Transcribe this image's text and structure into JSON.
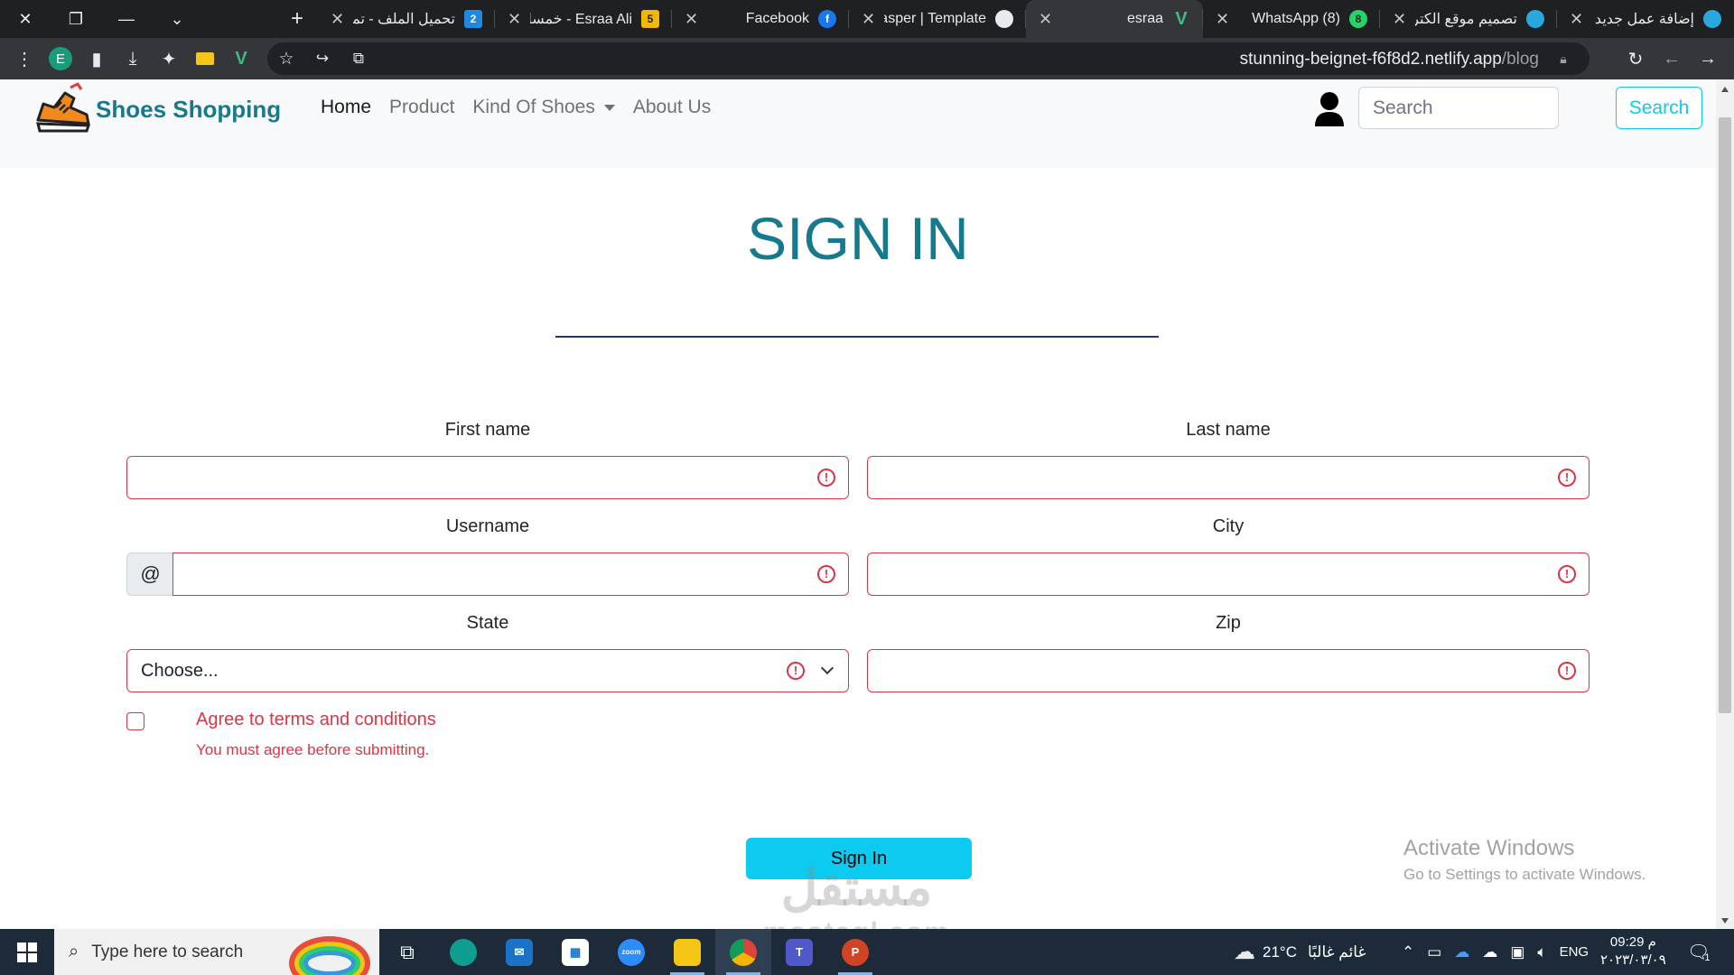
{
  "browser": {
    "tabs": [
      {
        "title": "إضافة عمل جديد |",
        "fav_color": "#29a8e0"
      },
      {
        "title": "تصميم موقع الكترو",
        "fav_color": "#29a8e0"
      },
      {
        "title": "(8) WhatsApp",
        "fav_color": "#25d366",
        "fav_text": "8"
      },
      {
        "title": "esraa",
        "fav_color": "#42b883",
        "active": true
      },
      {
        "title": "kasper | Template",
        "fav_color": "#e8eaed"
      },
      {
        "title": "Facebook",
        "fav_color": "#1877f2"
      },
      {
        "title": "Esraa Ali - خمسات",
        "fav_color": "#f2b705",
        "fav_text": "5"
      },
      {
        "title": "تحميل الملف - تمت",
        "fav_color": "#1e88e5",
        "fav_text": "2"
      }
    ],
    "profile_initial": "E",
    "url_host": "stunning-beignet-f6f8d2.netlify.app",
    "url_path": "/blog"
  },
  "navbar": {
    "brand": "Shoes Shopping",
    "links": [
      "Home",
      "Product",
      "Kind Of Shoes",
      "About Us"
    ],
    "search_placeholder": "Search",
    "search_button": "Search"
  },
  "form": {
    "title": "SIGN IN",
    "first_name_label": "First name",
    "last_name_label": "Last name",
    "username_label": "Username",
    "username_prefix": "@",
    "city_label": "City",
    "state_label": "State",
    "state_value": "Choose...",
    "zip_label": "Zip",
    "agree_label": "Agree to terms and conditions",
    "agree_feedback": "You must agree before submitting.",
    "submit_label": "Sign In"
  },
  "overlay": {
    "activate_line1": "Activate Windows",
    "activate_line2": "Go to Settings to activate Windows.",
    "watermark_ar": "مستقل",
    "watermark_lat": "mostaql.com"
  },
  "taskbar": {
    "search_placeholder": "Type here to search",
    "weather_temp": "21°C",
    "weather_text": "غائم غالبًا",
    "lang": "ENG",
    "time": "09:29 م",
    "date": "٢٠٢٣/٠٣/٠٩",
    "notif_count": "1"
  },
  "colors": {
    "brand": "#17798c",
    "invalid": "#dc3545",
    "primary_btn": "#0dcaf0"
  }
}
